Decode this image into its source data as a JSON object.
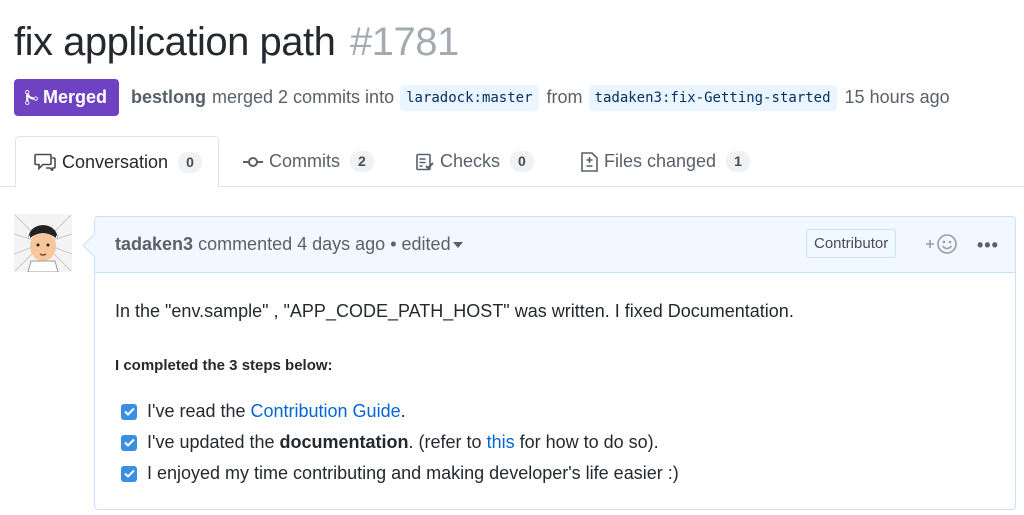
{
  "pr": {
    "title": "fix application path",
    "number": "#1781",
    "status": "Merged",
    "author": "bestlong",
    "merged_text": "merged 2 commits into",
    "base_branch": "laradock:master",
    "from_text": "from",
    "head_branch": "tadaken3:fix-Getting-started",
    "time": "15 hours ago"
  },
  "tabs": [
    {
      "label": "Conversation",
      "count": "0",
      "icon": "comment-icon"
    },
    {
      "label": "Commits",
      "count": "2",
      "icon": "commit-icon"
    },
    {
      "label": "Checks",
      "count": "0",
      "icon": "checklist-icon"
    },
    {
      "label": "Files changed",
      "count": "1",
      "icon": "file-diff-icon"
    }
  ],
  "comment": {
    "user": "tadaken3",
    "commented_text": "commented 4 days ago",
    "separator": "•",
    "edited_label": "edited",
    "role_badge": "Contributor",
    "more_label": "•••",
    "intro": "In the \"env.sample\" , \"APP_CODE_PATH_HOST\" was written. I fixed Documentation.",
    "heading": "I completed the 3 steps below:",
    "task1_pre": "I've read the ",
    "task1_link": "Contribution Guide",
    "task1_post": ".",
    "task2_pre": "I've updated the ",
    "task2_bold": "documentation",
    "task2_mid": ". (refer to ",
    "task2_link": "this",
    "task2_post": " for how to do so).",
    "task3": "I enjoyed my time contributing and making developer's life easier :)"
  },
  "colors": {
    "merged": "#6f42c1",
    "link": "#0366d6",
    "comment_border": "#c8e1ff",
    "comment_header": "#f1f8ff",
    "checkbox": "#3b8fe0"
  }
}
